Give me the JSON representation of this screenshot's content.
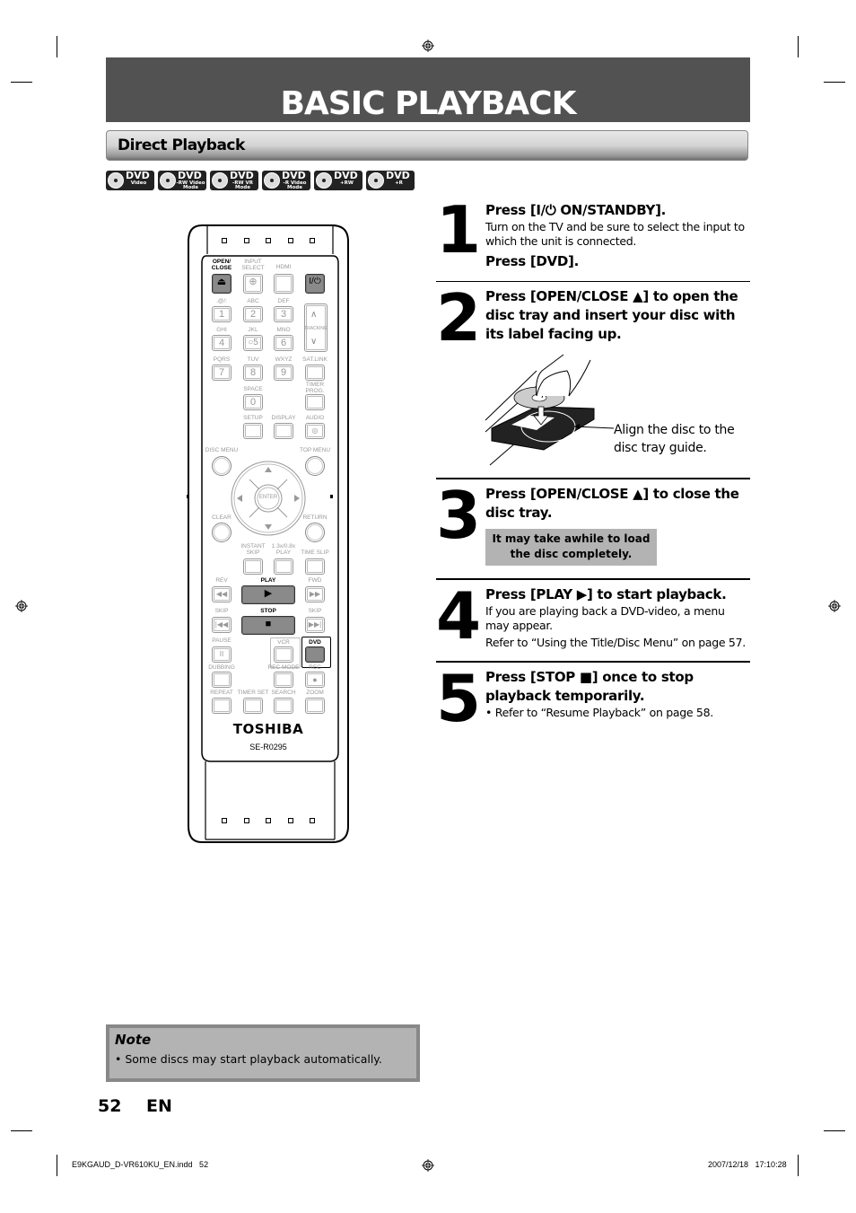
{
  "page": {
    "title": "BASIC PLAYBACK",
    "section": "Direct Playback",
    "page_number": "52",
    "language": "EN",
    "colors": {
      "title_bar": "#525252",
      "callout": "#b3b3b3",
      "note_border": "#888888"
    }
  },
  "disc_badges": [
    {
      "main": "DVD",
      "sub": "Video"
    },
    {
      "main": "DVD",
      "sub": "-RW Video Mode"
    },
    {
      "main": "DVD",
      "sub": "-RW VR Mode"
    },
    {
      "main": "DVD",
      "sub": "-R Video Mode"
    },
    {
      "main": "DVD",
      "sub": "+RW"
    },
    {
      "main": "DVD",
      "sub": "+R"
    }
  ],
  "steps": [
    {
      "number": "1",
      "heading": "Press [I/⏻ ON/STANDBY].",
      "body": "Turn on the TV and be sure to select the input to which the unit is connected.",
      "heading2": "Press [DVD]."
    },
    {
      "number": "2",
      "heading": "Press [OPEN/CLOSE ▲] to open the disc tray and insert your disc with its label facing up.",
      "illustration_caption": "Align the disc to the disc tray guide."
    },
    {
      "number": "3",
      "heading": "Press [OPEN/CLOSE ▲] to close the disc tray.",
      "callout": "It may take awhile to load the disc completely."
    },
    {
      "number": "4",
      "heading": "Press [PLAY ▶] to start playback.",
      "body": "If you are playing back a DVD-video, a menu may appear.",
      "body2": "Refer to “Using the Title/Disc Menu” on page 57."
    },
    {
      "number": "5",
      "heading": "Press [STOP ■] once to stop playback temporarily.",
      "body": "• Refer to “Resume Playback” on page 58."
    }
  ],
  "note": {
    "title": "Note",
    "items": [
      "• Some discs may start playback automatically."
    ]
  },
  "footer": {
    "file": "E9KGAUD_D-VR610KU_EN.indd   52",
    "timestamp": "2007/12/18   17:10:28"
  },
  "remote": {
    "brand": "TOSHIBA",
    "model": "SE-R0295",
    "labels": {
      "open_close": "OPEN/ CLOSE",
      "input_select": "INPUT SELECT",
      "hdmi": "HDMI",
      "k1": ".@/:",
      "k2": "ABC",
      "k3": "DEF",
      "k4": "GHI",
      "k5": "JKL",
      "k6": "MNO",
      "k7": "PQRS",
      "k8": "TUV",
      "k9": "WXYZ",
      "sat_link": "SAT.LINK",
      "space": "SPACE",
      "timer_prog": "TIMER PROG.",
      "tracking": "TRACKING",
      "setup": "SETUP",
      "display": "DISPLAY",
      "audio": "AUDIO",
      "disc_menu": "DISC MENU",
      "top_menu": "TOP MENU",
      "enter": "ENTER",
      "clear": "CLEAR",
      "return": "RETURN",
      "instant_skip": "INSTANT SKIP",
      "speed_play": "1.3x/0.8x PLAY",
      "time_slip": "TIME SLIP",
      "rev": "REV",
      "play": "PLAY",
      "fwd": "FWD",
      "skip_back": "SKIP",
      "stop": "STOP",
      "skip_fwd": "SKIP",
      "pause": "PAUSE",
      "vcr": "VCR",
      "dvd": "DVD",
      "dubbing": "DUBBING",
      "rec_mode": "REC MODE",
      "rec": "REC",
      "repeat": "REPEAT",
      "timer_set": "TIMER SET",
      "search": "SEARCH",
      "zoom": "ZOOM"
    },
    "keys": {
      "n1": "1",
      "n2": "2",
      "n3": "3",
      "n4": "4",
      "n5": "○5",
      "n6": "6",
      "n7": "7",
      "n8": "8",
      "n9": "9",
      "n0": "0",
      "power": "I/⏻"
    }
  }
}
